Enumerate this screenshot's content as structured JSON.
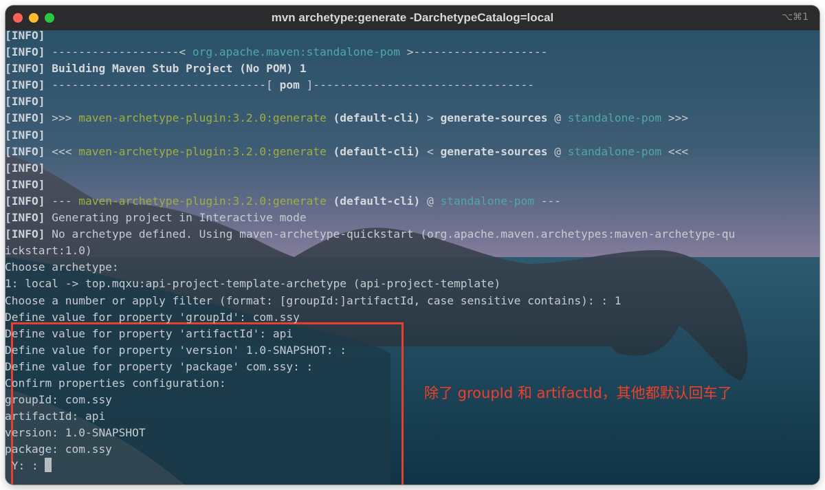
{
  "window": {
    "title": "mvn archetype:generate -DarchetypeCatalog=local",
    "shortcut": "⌥⌘1"
  },
  "terminal": {
    "lines": [
      [
        {
          "t": "[INFO]",
          "s": "tag"
        }
      ],
      [
        {
          "t": "[INFO]",
          "s": "tag"
        },
        {
          "t": " -------------------< ",
          "s": ""
        },
        {
          "t": "org.apache.maven:standalone-pom",
          "s": "c"
        },
        {
          "t": " >--------------------",
          "s": ""
        }
      ],
      [
        {
          "t": "[INFO]",
          "s": "tag"
        },
        {
          "t": " Building Maven Stub Project (No POM) 1",
          "s": "b"
        }
      ],
      [
        {
          "t": "[INFO]",
          "s": "tag"
        },
        {
          "t": " --------------------------------[ ",
          "s": ""
        },
        {
          "t": "pom",
          "s": "b"
        },
        {
          "t": " ]---------------------------------",
          "s": ""
        }
      ],
      [
        {
          "t": "[INFO]",
          "s": "tag"
        }
      ],
      [
        {
          "t": "[INFO]",
          "s": "tag"
        },
        {
          "t": " >>> ",
          "s": ""
        },
        {
          "t": "maven-archetype-plugin:3.2.0:generate",
          "s": "g"
        },
        {
          "t": " (default-cli)",
          "s": "b"
        },
        {
          "t": " > ",
          "s": ""
        },
        {
          "t": "generate-sources",
          "s": "b"
        },
        {
          "t": " @ ",
          "s": ""
        },
        {
          "t": "standalone-pom",
          "s": "c"
        },
        {
          "t": " >>>",
          "s": ""
        }
      ],
      [
        {
          "t": "[INFO]",
          "s": "tag"
        }
      ],
      [
        {
          "t": "[INFO]",
          "s": "tag"
        },
        {
          "t": " <<< ",
          "s": ""
        },
        {
          "t": "maven-archetype-plugin:3.2.0:generate",
          "s": "g"
        },
        {
          "t": " (default-cli)",
          "s": "b"
        },
        {
          "t": " < ",
          "s": ""
        },
        {
          "t": "generate-sources",
          "s": "b"
        },
        {
          "t": " @ ",
          "s": ""
        },
        {
          "t": "standalone-pom",
          "s": "c"
        },
        {
          "t": " <<<",
          "s": ""
        }
      ],
      [
        {
          "t": "[INFO]",
          "s": "tag"
        }
      ],
      [
        {
          "t": "[INFO]",
          "s": "tag"
        }
      ],
      [
        {
          "t": "[INFO]",
          "s": "tag"
        },
        {
          "t": " --- ",
          "s": ""
        },
        {
          "t": "maven-archetype-plugin:3.2.0:generate",
          "s": "g"
        },
        {
          "t": " (default-cli)",
          "s": "b"
        },
        {
          "t": " @ ",
          "s": ""
        },
        {
          "t": "standalone-pom",
          "s": "c"
        },
        {
          "t": " ---",
          "s": ""
        }
      ],
      [
        {
          "t": "[INFO]",
          "s": "tag"
        },
        {
          "t": " Generating project in Interactive mode",
          "s": ""
        }
      ],
      [
        {
          "t": "[INFO]",
          "s": "tag"
        },
        {
          "t": " No archetype defined. Using maven-archetype-quickstart (org.apache.maven.archetypes:maven-archetype-qu",
          "s": ""
        }
      ],
      [
        {
          "t": "ickstart:1.0)",
          "s": ""
        }
      ],
      [
        {
          "t": "Choose archetype:",
          "s": ""
        }
      ],
      [
        {
          "t": "1: local -> top.mqxu:api-project-template-archetype (api-project-template)",
          "s": ""
        }
      ],
      [
        {
          "t": "Choose a number or apply filter (format: [groupId:]artifactId, case sensitive contains): : 1",
          "s": ""
        }
      ],
      [
        {
          "t": "Define value for property 'groupId': com.ssy",
          "s": ""
        }
      ],
      [
        {
          "t": "Define value for property 'artifactId': api",
          "s": ""
        }
      ],
      [
        {
          "t": "Define value for property 'version' 1.0-SNAPSHOT: :",
          "s": ""
        }
      ],
      [
        {
          "t": "Define value for property 'package' com.ssy: :",
          "s": ""
        }
      ],
      [
        {
          "t": "Confirm properties configuration:",
          "s": ""
        }
      ],
      [
        {
          "t": "groupId: com.ssy",
          "s": ""
        }
      ],
      [
        {
          "t": "artifactId: api",
          "s": ""
        }
      ],
      [
        {
          "t": "version: 1.0-SNAPSHOT",
          "s": ""
        }
      ],
      [
        {
          "t": "package: com.ssy",
          "s": ""
        }
      ],
      [
        {
          "t": " Y: : ",
          "s": ""
        }
      ]
    ]
  },
  "annotation": {
    "text": "除了 groupId 和 artifactId，其他都默认回车了",
    "color": "#f0402a"
  },
  "colors": {
    "tag": "#d0d4d8",
    "plugin_green": "#a2ad41",
    "pom_cyan": "#4fa9a4"
  }
}
